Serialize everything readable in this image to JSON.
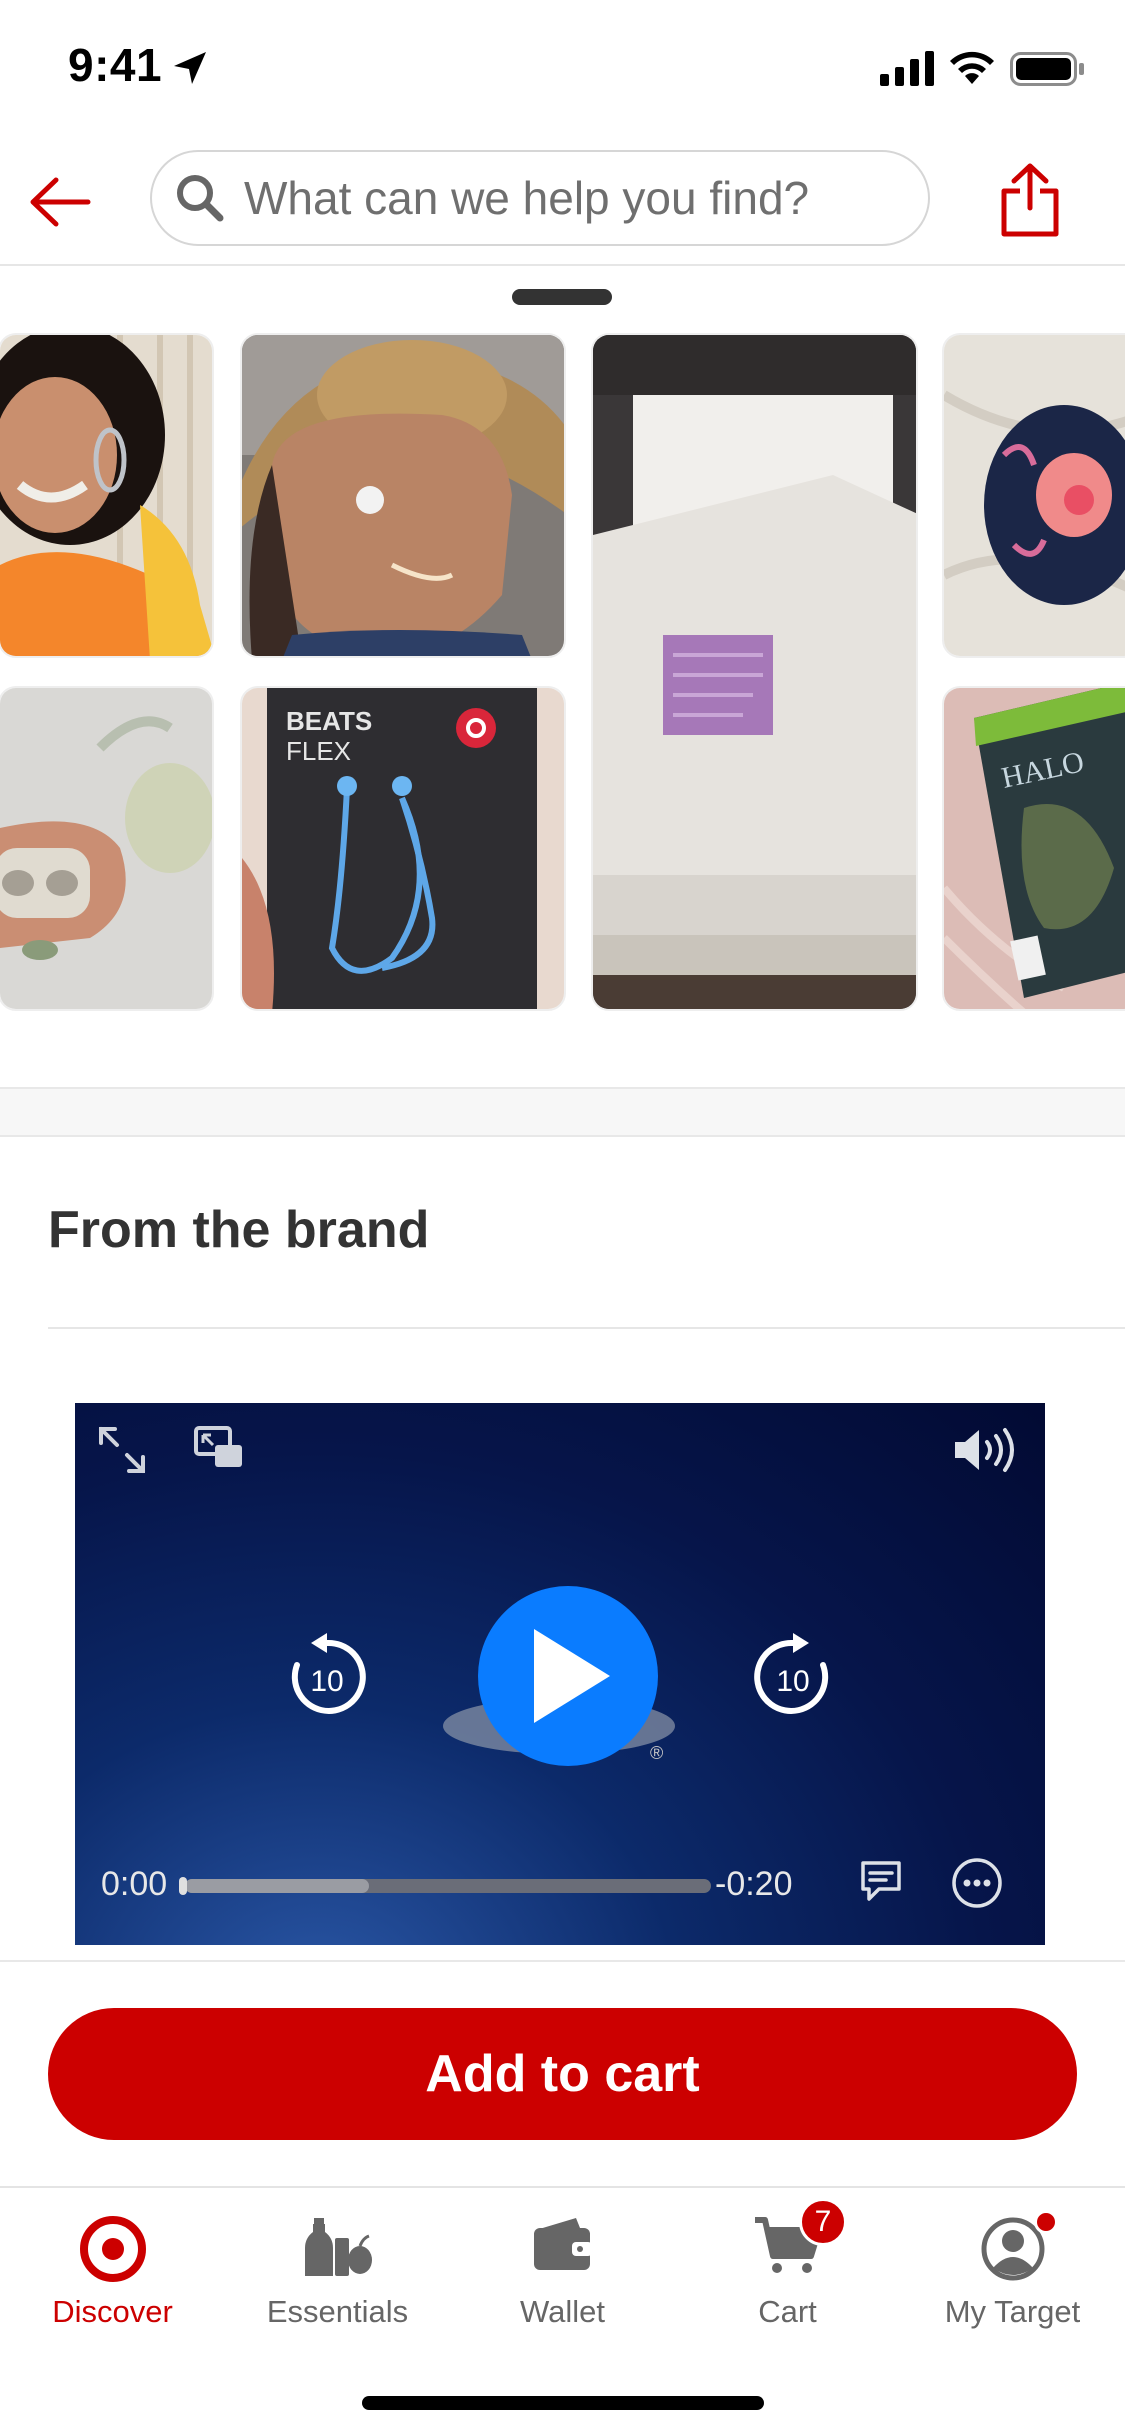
{
  "status_bar": {
    "time": "9:41"
  },
  "header": {
    "search_placeholder": "What can we help you find?"
  },
  "photos": [
    {
      "name": "photo-woman-orange-sweater-earbud"
    },
    {
      "name": "photo-woman-cowboy-hat-earbud"
    },
    {
      "name": "photo-white-printer"
    },
    {
      "name": "photo-floral-mouse"
    },
    {
      "name": "photo-earbuds-case"
    },
    {
      "name": "photo-beats-flex-box",
      "box_text_1": "BEATS",
      "box_text_2": "FLEX"
    },
    {
      "name": "photo-halo-game-case"
    }
  ],
  "brand_section": {
    "title": "From the brand"
  },
  "video": {
    "time_current": "0:00",
    "time_remaining": "-0:20",
    "skip_back_label": "10",
    "skip_forward_label": "10",
    "registered_mark": "®",
    "buffered_fraction": 0.35
  },
  "cart_bar": {
    "add_to_cart_label": "Add to cart"
  },
  "tabs": [
    {
      "label": "Discover",
      "icon": "target-logo-icon",
      "active": true
    },
    {
      "label": "Essentials",
      "icon": "essentials-icon",
      "active": false
    },
    {
      "label": "Wallet",
      "icon": "wallet-icon",
      "active": false
    },
    {
      "label": "Cart",
      "icon": "cart-icon",
      "active": false,
      "badge": "7"
    },
    {
      "label": "My Target",
      "icon": "profile-icon",
      "active": false
    }
  ],
  "colors": {
    "brand_red": "#cc0000",
    "play_blue": "#0a7cff"
  }
}
